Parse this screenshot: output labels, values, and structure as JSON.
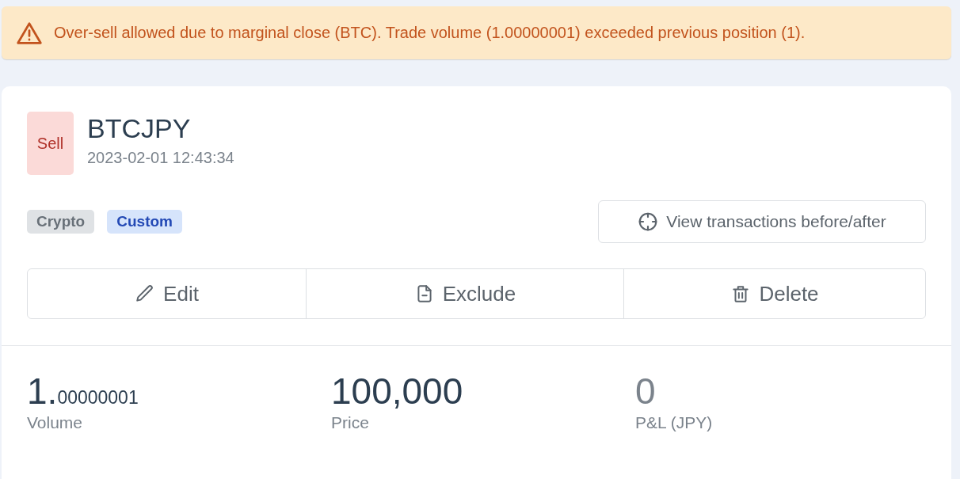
{
  "alert": {
    "kind": "warning",
    "message": "Over-sell allowed due to marginal close (BTC). Trade volume (1.00000001) exceeded previous position (1)."
  },
  "trade": {
    "side": {
      "label": "Sell",
      "kind": "sell"
    },
    "symbol": "BTCJPY",
    "timestamp": "2023-02-01 12:43:34"
  },
  "tags": [
    {
      "label": "Crypto",
      "kind": "neutral"
    },
    {
      "label": "Custom",
      "kind": "info"
    }
  ],
  "context_button": {
    "label": "View transactions before/after"
  },
  "actions": [
    {
      "label": "Edit",
      "kind": "edit"
    },
    {
      "label": "Exclude",
      "kind": "exclude"
    },
    {
      "label": "Delete",
      "kind": "delete"
    }
  ],
  "stats": [
    {
      "value": "1.",
      "fraction": "00000001",
      "label": "Volume",
      "muted": false
    },
    {
      "value": "100,000",
      "label": "Price",
      "muted": false
    },
    {
      "value": "0",
      "label": "P&L (JPY)",
      "muted": true
    }
  ]
}
